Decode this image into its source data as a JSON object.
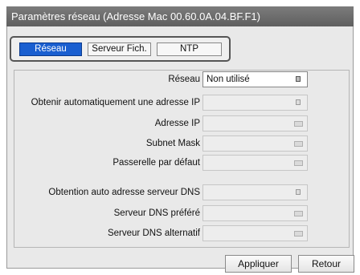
{
  "window": {
    "title": "Paramètres réseau (Adresse Mac 00.60.0A.04.BF.F1)"
  },
  "tabs": [
    {
      "label": "Réseau",
      "active": true
    },
    {
      "label": "Serveur Fich.",
      "active": false
    },
    {
      "label": "NTP",
      "active": false
    }
  ],
  "form": {
    "network": {
      "label": "Réseau",
      "value": "Non utilisé",
      "icon": "dropdown-icon",
      "enabled": true
    },
    "auto_ip": {
      "label": "Obtenir automatiquement une adresse IP",
      "value": "",
      "icon": "dropdown-icon",
      "enabled": false
    },
    "ip_address": {
      "label": "Adresse IP",
      "value": "",
      "icon": "keyboard-icon",
      "enabled": false
    },
    "subnet_mask": {
      "label": "Subnet Mask",
      "value": "",
      "icon": "keyboard-icon",
      "enabled": false
    },
    "gateway": {
      "label": "Passerelle par défaut",
      "value": "",
      "icon": "keyboard-icon",
      "enabled": false
    },
    "auto_dns": {
      "label": "Obtention auto adresse serveur DNS",
      "value": "",
      "icon": "dropdown-icon",
      "enabled": false
    },
    "preferred_dns": {
      "label": "Serveur DNS préféré",
      "value": "",
      "icon": "keyboard-icon",
      "enabled": false
    },
    "alternate_dns": {
      "label": "Serveur DNS alternatif",
      "value": "",
      "icon": "keyboard-icon",
      "enabled": false
    }
  },
  "buttons": {
    "apply": "Appliquer",
    "back": "Retour"
  },
  "colors": {
    "titlebar": "#6b6b6b",
    "active_tab": "#1a5fd0",
    "panel": "#e9e9e9"
  }
}
